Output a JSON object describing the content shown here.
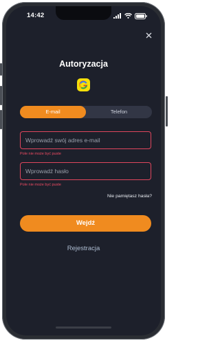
{
  "status_bar": {
    "time": "14:42"
  },
  "header": {
    "title": "Autoryzacja"
  },
  "tabs": [
    {
      "label": "E-mail",
      "active": true
    },
    {
      "label": "Telefon",
      "active": false
    }
  ],
  "form": {
    "email": {
      "placeholder": "Wprowadź swój adres e-mail",
      "value": "",
      "error": "Pole nie może być puste"
    },
    "password": {
      "placeholder": "Wprowadź hasło",
      "value": "",
      "error": "Pole nie może być puste"
    },
    "forgot_label": "Nie pamiętasz hasła?",
    "submit_label": "Wejdź",
    "register_label": "Rejestracja"
  },
  "colors": {
    "accent": "#f08b1f",
    "background": "#1d202b",
    "error": "#ef4b63",
    "logo_bg": "#f5df0a"
  },
  "icons": [
    "signal-icon",
    "wifi-icon",
    "battery-icon",
    "close-icon",
    "app-logo-icon"
  ]
}
